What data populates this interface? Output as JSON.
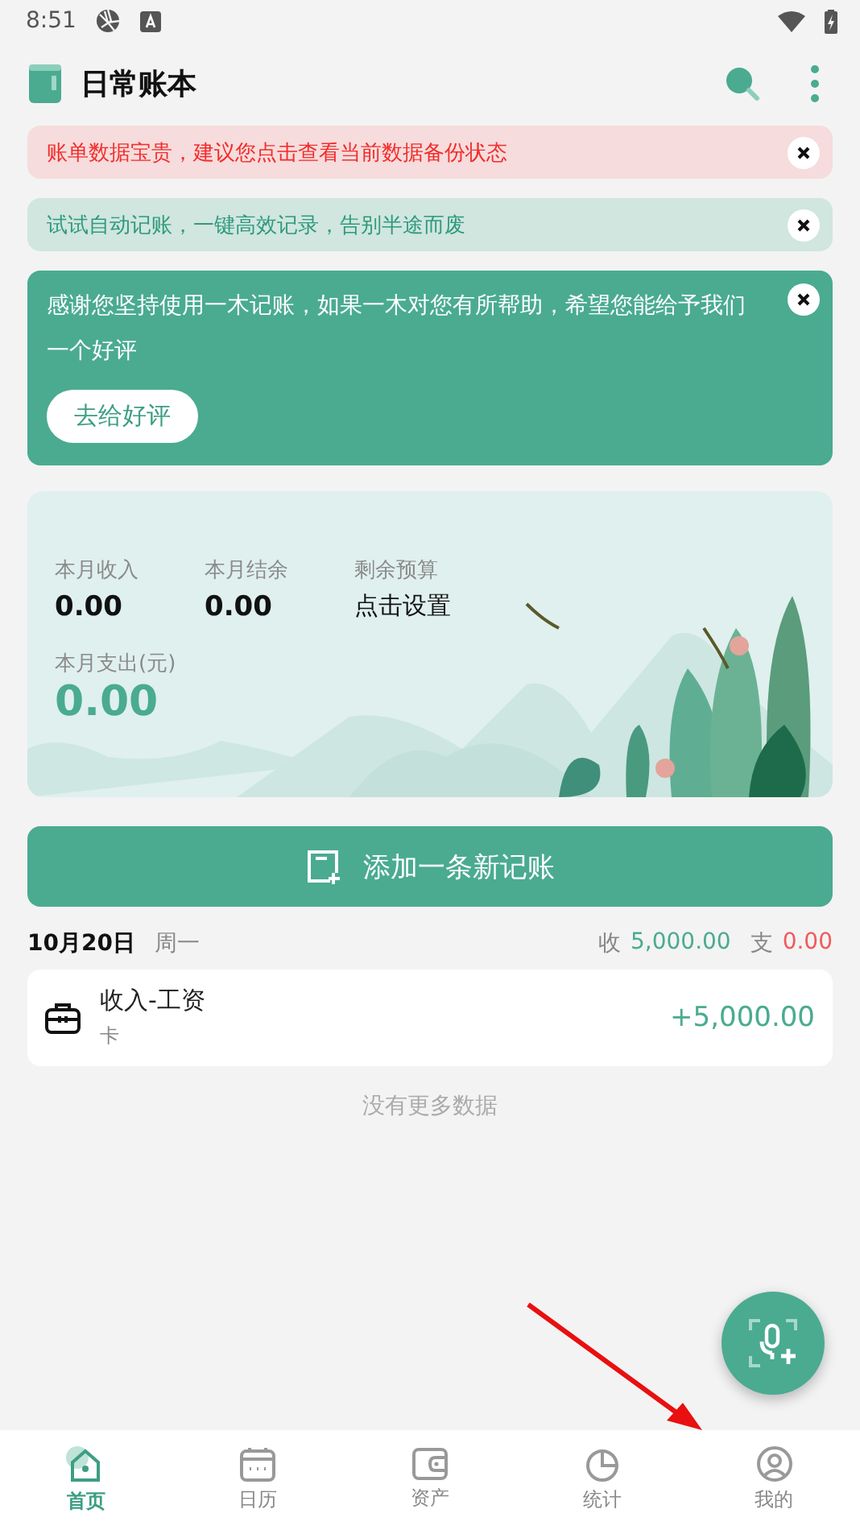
{
  "status_bar": {
    "time": "8:51"
  },
  "app_bar": {
    "title": "日常账本"
  },
  "notices": [
    {
      "kind": "warning",
      "text": "账单数据宝贵，建议您点击查看当前数据备份状态"
    },
    {
      "kind": "tip",
      "text": "试试自动记账，一键高效记录，告别半途而废"
    }
  ],
  "review_card": {
    "text": "感谢您坚持使用一木记账，如果一木对您有所帮助，希望您能给予我们一个好评",
    "button": "去给好评"
  },
  "summary": {
    "items": [
      {
        "label": "本月收入",
        "value": "0.00"
      },
      {
        "label": "本月结余",
        "value": "0.00"
      },
      {
        "label": "剩余预算",
        "value": "点击设置"
      }
    ],
    "expense_label": "本月支出(元)",
    "expense_value": "0.00"
  },
  "add_button": "添加一条新记账",
  "day": {
    "date": "10月20日",
    "weekday": "周一",
    "income_label": "收",
    "income": "5,000.00",
    "expense_label": "支",
    "expense": "0.00",
    "entries": [
      {
        "title": "收入-工资",
        "account": "卡",
        "amount": "+5,000.00"
      }
    ]
  },
  "end_text": "没有更多数据",
  "tabs": [
    {
      "label": "首页",
      "selected": true
    },
    {
      "label": "日历",
      "selected": false
    },
    {
      "label": "资产",
      "selected": false
    },
    {
      "label": "统计",
      "selected": false
    },
    {
      "label": "我的",
      "selected": false
    }
  ]
}
